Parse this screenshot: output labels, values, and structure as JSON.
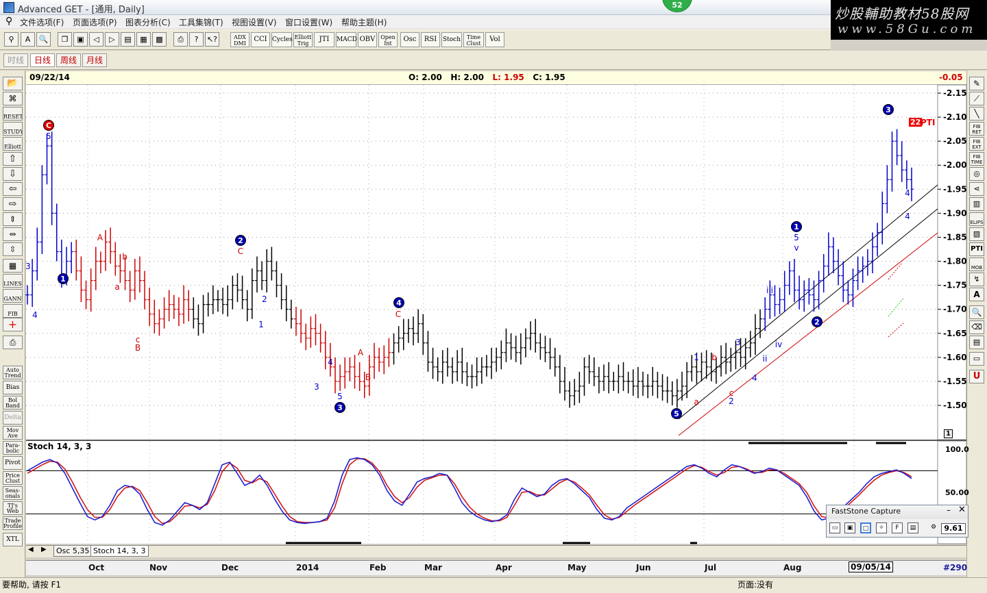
{
  "window": {
    "title": "Advanced GET - [通用, Daily]",
    "badge": "52"
  },
  "watermark": {
    "line1": "炒股輔助教材58股网",
    "line2": "www.58Gu.com"
  },
  "menu": [
    "文件选项(F)",
    "页面选项(P)",
    "图表分析(C)",
    "工具集锦(T)",
    "视图设置(V)",
    "窗口设置(W)",
    "帮助主题(H)"
  ],
  "toolbar": {
    "studies": [
      {
        "label": "ADX DMI"
      },
      {
        "label": "CCI"
      },
      {
        "label": "Cycles"
      },
      {
        "label": "Elliott Trig"
      },
      {
        "label": "JTI"
      },
      {
        "label": "MACD"
      },
      {
        "label": "OBV"
      },
      {
        "label": "Open Int"
      },
      {
        "label": "Osc"
      },
      {
        "label": "RSI"
      },
      {
        "label": "Stoch"
      },
      {
        "label": "Time Clust"
      },
      {
        "label": "Vol"
      }
    ]
  },
  "timeframes": [
    "时线",
    "日线",
    "周线",
    "月线"
  ],
  "left_palette": [
    "RESET",
    "STUDY",
    "Elliott",
    "LINES",
    "GANN",
    "FIB",
    "Auto Trend",
    "Bias",
    "Bol Band",
    "Delta",
    "Mov Ave",
    "Para-bolic",
    "Pivot",
    "Price Clust",
    "Seas-onals",
    "TJ's Web",
    "Trade Profile",
    "XTL"
  ],
  "right_palette": [
    "FIB RET",
    "FIB EXT",
    "FIB TIME",
    "ELIPS",
    "PTI",
    "MOB",
    "A",
    "U"
  ],
  "info": {
    "date": "09/22/14",
    "open_label": "O:",
    "open": "2.00",
    "high_label": "H:",
    "high": "2.00",
    "low_label": "L:",
    "low": "1.95",
    "close_label": "C:",
    "close": "1.95",
    "change": "-0.05"
  },
  "chart_data": {
    "type": "ohlc",
    "price_axis": [
      "2.15",
      "2.10",
      "2.05",
      "2.00",
      "1.95",
      "1.90",
      "1.85",
      "1.80",
      "1.75",
      "1.70",
      "1.65",
      "1.60",
      "1.55",
      "1.50"
    ],
    "price_scale_marker": "1",
    "pti_label": "22",
    "pti_text": "PTI",
    "close_series": [
      1.73,
      1.78,
      1.84,
      1.98,
      2.04,
      1.9,
      1.82,
      1.77,
      1.8,
      1.82,
      1.78,
      1.74,
      1.72,
      1.76,
      1.8,
      1.8,
      1.84,
      1.82,
      1.79,
      1.78,
      1.76,
      1.74,
      1.78,
      1.76,
      1.72,
      1.69,
      1.67,
      1.68,
      1.7,
      1.71,
      1.7,
      1.69,
      1.72,
      1.7,
      1.68,
      1.67,
      1.71,
      1.71,
      1.72,
      1.72,
      1.71,
      1.72,
      1.75,
      1.74,
      1.72,
      1.7,
      1.76,
      1.78,
      1.76,
      1.8,
      1.78,
      1.75,
      1.72,
      1.7,
      1.68,
      1.67,
      1.65,
      1.64,
      1.66,
      1.65,
      1.63,
      1.6,
      1.58,
      1.55,
      1.56,
      1.57,
      1.58,
      1.56,
      1.55,
      1.54,
      1.58,
      1.6,
      1.59,
      1.6,
      1.61,
      1.63,
      1.64,
      1.65,
      1.66,
      1.65,
      1.67,
      1.63,
      1.59,
      1.58,
      1.57,
      1.59,
      1.58,
      1.57,
      1.59,
      1.57,
      1.56,
      1.56,
      1.57,
      1.58,
      1.58,
      1.59,
      1.6,
      1.61,
      1.63,
      1.62,
      1.61,
      1.62,
      1.64,
      1.65,
      1.63,
      1.62,
      1.61,
      1.6,
      1.58,
      1.55,
      1.53,
      1.52,
      1.53,
      1.54,
      1.58,
      1.57,
      1.56,
      1.55,
      1.56,
      1.55,
      1.55,
      1.56,
      1.55,
      1.55,
      1.54,
      1.55,
      1.54,
      1.54,
      1.55,
      1.54,
      1.53,
      1.53,
      1.52,
      1.53,
      1.54,
      1.57,
      1.58,
      1.57,
      1.59,
      1.58,
      1.57,
      1.58,
      1.6,
      1.59,
      1.6,
      1.61,
      1.6,
      1.62,
      1.63,
      1.66,
      1.68,
      1.7,
      1.73,
      1.71,
      1.72,
      1.75,
      1.78,
      1.74,
      1.72,
      1.74,
      1.73,
      1.72,
      1.76,
      1.79,
      1.83,
      1.8,
      1.77,
      1.74,
      1.73,
      1.76,
      1.78,
      1.79,
      1.8,
      1.83,
      1.86,
      1.92,
      1.97,
      2.05,
      2.02,
      1.99,
      1.97,
      1.95
    ],
    "elliott_labels": [
      {
        "t": "C",
        "kind": "circle-red"
      },
      {
        "t": "5"
      },
      {
        "t": "3"
      },
      {
        "t": "4"
      },
      {
        "t": "1",
        "kind": "circle-blue"
      },
      {
        "t": "A"
      },
      {
        "t": "b"
      },
      {
        "t": "a"
      },
      {
        "t": "c"
      },
      {
        "t": "B"
      },
      {
        "t": "2",
        "kind": "circle-blue"
      },
      {
        "t": "C"
      },
      {
        "t": "2"
      },
      {
        "t": "1"
      },
      {
        "t": "4"
      },
      {
        "t": "3"
      },
      {
        "t": "5"
      },
      {
        "t": "3",
        "kind": "circle-blue"
      },
      {
        "t": "A"
      },
      {
        "t": "B"
      },
      {
        "t": "4",
        "kind": "circle-blue"
      },
      {
        "t": "C"
      },
      {
        "t": "5",
        "kind": "circle-blue"
      },
      {
        "t": "a"
      },
      {
        "t": "1"
      },
      {
        "t": "b"
      },
      {
        "t": "c"
      },
      {
        "t": "2"
      },
      {
        "t": "3"
      },
      {
        "t": "4"
      },
      {
        "t": "iii"
      },
      {
        "t": "iv"
      },
      {
        "t": "ii"
      },
      {
        "t": "1",
        "kind": "circle-blue"
      },
      {
        "t": "5"
      },
      {
        "t": "v"
      },
      {
        "t": "2",
        "kind": "circle-blue"
      },
      {
        "t": "3",
        "kind": "circle-blue"
      },
      {
        "t": "4"
      },
      {
        "t": "4"
      }
    ],
    "osc": {
      "title": "Stoch 14, 3, 3",
      "axis": [
        "100.0",
        "50.00"
      ],
      "k_series": [
        75,
        80,
        85,
        88,
        84,
        72,
        55,
        38,
        22,
        18,
        22,
        35,
        52,
        58,
        56,
        48,
        30,
        15,
        12,
        18,
        28,
        38,
        35,
        30,
        38,
        60,
        82,
        85,
        72,
        58,
        62,
        70,
        58,
        42,
        28,
        18,
        15,
        14,
        15,
        16,
        20,
        40,
        70,
        88,
        90,
        88,
        82,
        70,
        52,
        40,
        35,
        48,
        62,
        66,
        68,
        72,
        70,
        55,
        38,
        28,
        22,
        18,
        16,
        18,
        24,
        42,
        55,
        50,
        45,
        48,
        58,
        64,
        66,
        60,
        52,
        44,
        30,
        20,
        18,
        22,
        32,
        38,
        44,
        50,
        56,
        62,
        68,
        74,
        80,
        82,
        78,
        72,
        68,
        76,
        82,
        80,
        76,
        72,
        74,
        78,
        76,
        70,
        64,
        58,
        45,
        28,
        18,
        20,
        26,
        34,
        42,
        50,
        60,
        68,
        72,
        74,
        76,
        72,
        66
      ],
      "d_series": [
        72,
        77,
        82,
        86,
        85,
        77,
        62,
        45,
        30,
        21,
        21,
        30,
        45,
        55,
        57,
        52,
        38,
        22,
        14,
        16,
        24,
        34,
        35,
        32,
        36,
        52,
        74,
        84,
        78,
        64,
        61,
        66,
        62,
        48,
        34,
        22,
        16,
        15,
        15,
        16,
        18,
        32,
        60,
        82,
        89,
        89,
        84,
        74,
        58,
        45,
        38,
        44,
        56,
        64,
        67,
        70,
        70,
        60,
        45,
        33,
        25,
        20,
        17,
        17,
        21,
        35,
        50,
        51,
        47,
        47,
        54,
        61,
        65,
        62,
        55,
        47,
        35,
        24,
        19,
        21,
        28,
        35,
        41,
        47,
        53,
        59,
        65,
        71,
        77,
        81,
        79,
        74,
        70,
        73,
        79,
        80,
        77,
        73,
        73,
        76,
        76,
        72,
        66,
        60,
        50,
        34,
        22,
        20,
        24,
        31,
        39,
        47,
        56,
        64,
        70,
        73,
        75,
        73,
        68
      ]
    },
    "months": [
      "Oct",
      "Nov",
      "Dec",
      "2014",
      "Feb",
      "Mar",
      "Apr",
      "May",
      "Jun",
      "Jul",
      "Aug"
    ],
    "cursor_date": "09/05/14",
    "bar_count": "#290",
    "colors": {
      "blue": "#0000cc",
      "red": "#cc0000",
      "black": "#000000",
      "k_line": "#1f1fd0",
      "d_line": "#d01818"
    }
  },
  "tabs": [
    "Osc 5,35",
    "Stoch 14, 3, 3"
  ],
  "status": {
    "help": "要帮助, 请按 F1",
    "page": "页面:没有"
  },
  "faststone": {
    "title": "FastStone Capture",
    "value": "9.61"
  }
}
